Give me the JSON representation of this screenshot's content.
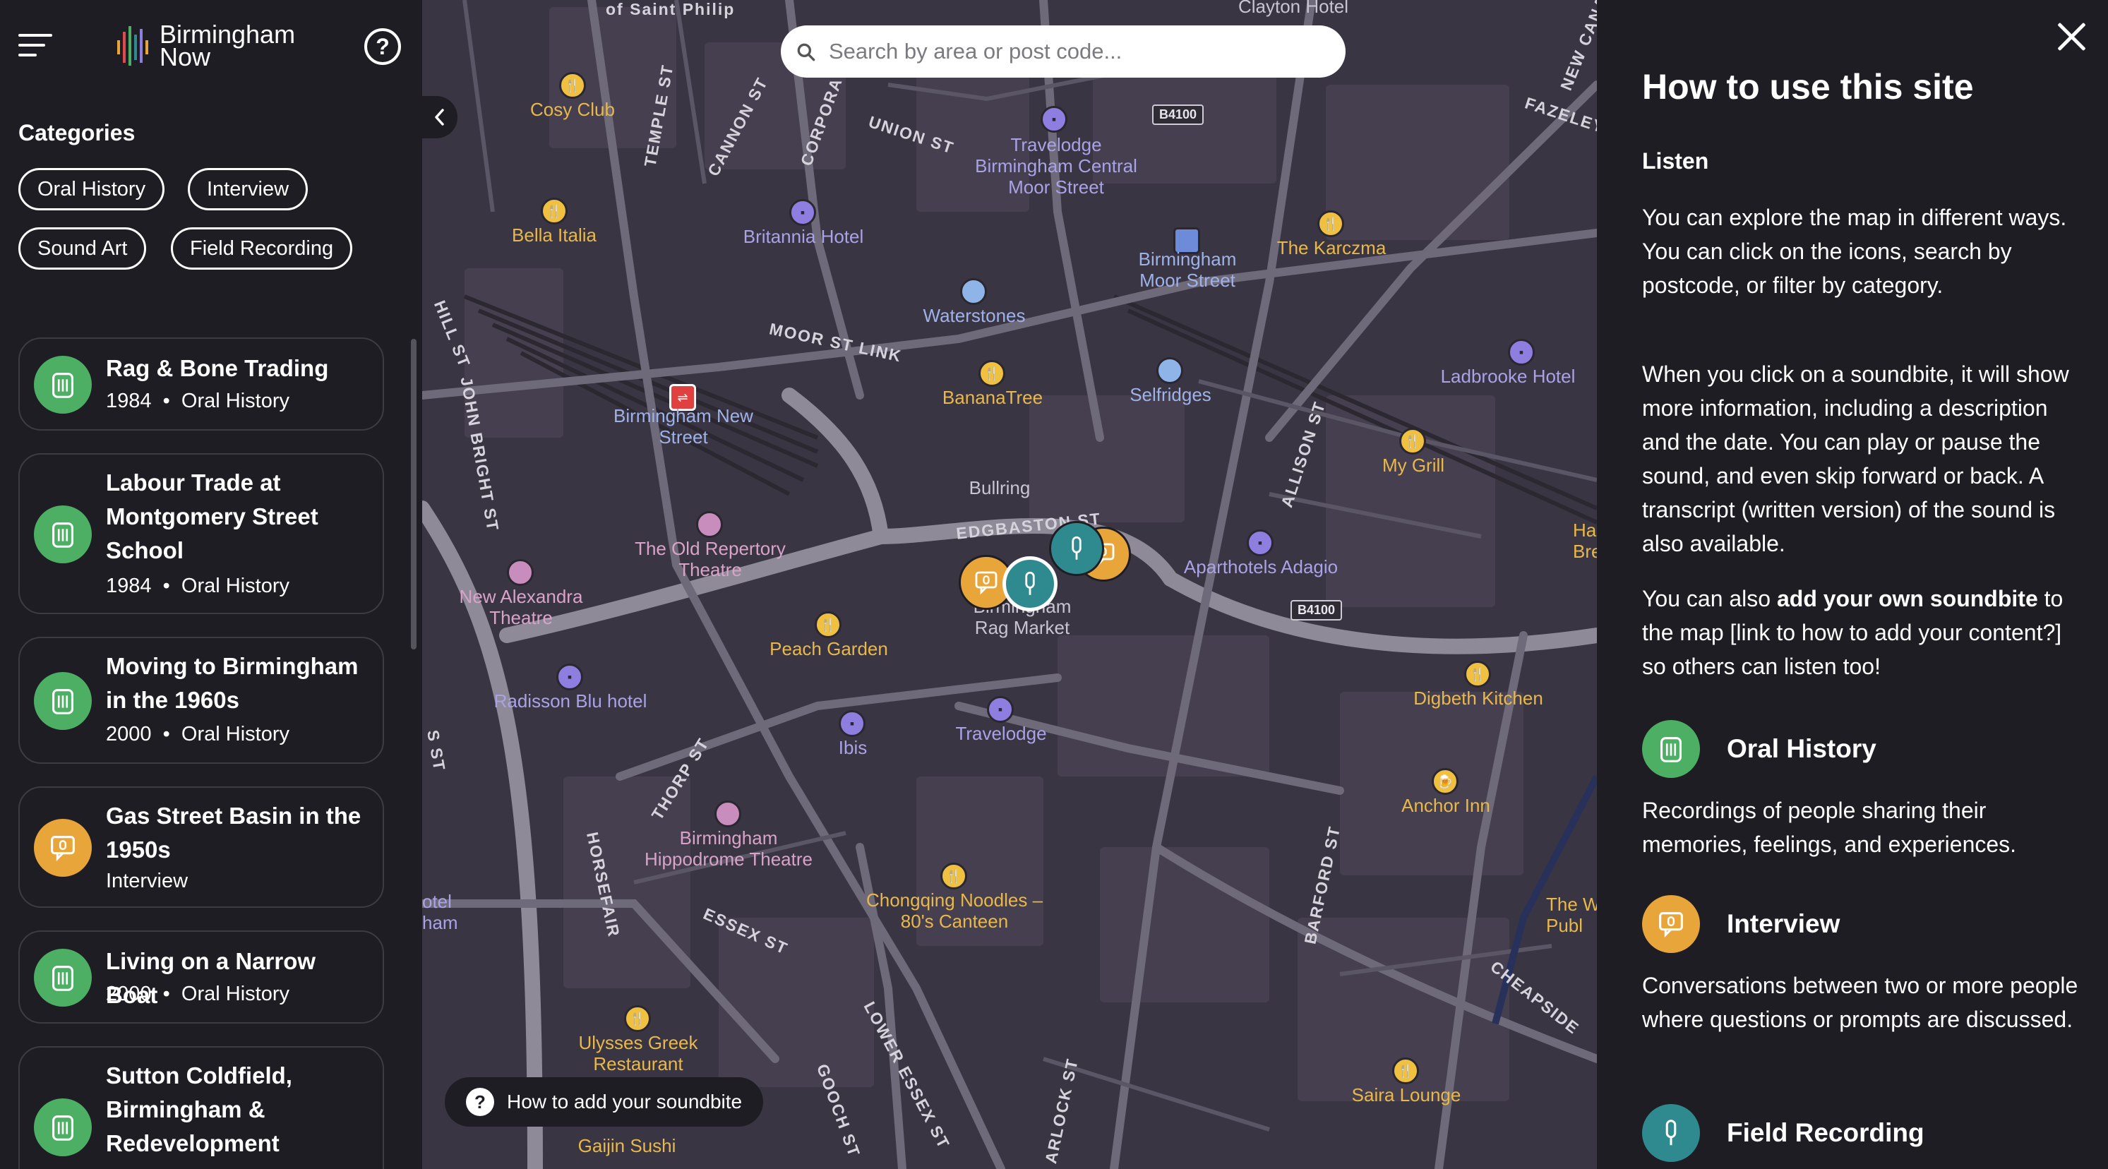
{
  "app": {
    "logo_line1": "Birmingham",
    "logo_line2": "Now",
    "help_label": "?"
  },
  "sidebar": {
    "categories_heading": "Categories",
    "chips": [
      "Oral History",
      "Interview",
      "Sound Art",
      "Field Recording"
    ],
    "cards": [
      {
        "title": "Rag & Bone Trading",
        "year": "1984",
        "category": "Oral History",
        "type": "oral"
      },
      {
        "title": "Labour Trade at Montgomery Street School",
        "year": "1984",
        "category": "Oral History",
        "type": "oral"
      },
      {
        "title": "Moving to Birmingham in the 1960s",
        "year": "2000",
        "category": "Oral History",
        "type": "oral"
      },
      {
        "title": "Gas Street Basin in the 1950s",
        "year": "",
        "category": "Interview",
        "type": "interview"
      },
      {
        "title": "Living on a Narrow Boat",
        "year": "2000",
        "category": "Oral History",
        "type": "oral"
      },
      {
        "title": "Sutton Coldfield, Birmingham & Redevelopment",
        "year": "",
        "category": "",
        "type": "oral"
      }
    ]
  },
  "map": {
    "search_placeholder": "Search by area or post code...",
    "how_to_add": "How to add your soundbite",
    "question_mark": "?",
    "streets": [
      "of Saint Philip",
      "UNION ST",
      "CANNON ST",
      "TEMPLE ST",
      "CORPORATION",
      "MOOR ST LINK",
      "HILL ST",
      "JOHN BRIGHT ST",
      "EDGBASTON ST",
      "ALLISON ST",
      "BARFORD ST",
      "CHEAPSIDE",
      "ESSEX ST",
      "THORP ST",
      "HORSEFAIR",
      "LOWER ESSEX ST",
      "GOOCH ST",
      "FAZELEY",
      "NEW CANAL",
      "S ST",
      "ARLOCK ST",
      "Clayton Hotel"
    ],
    "road_shields": [
      "B4100",
      "B4100"
    ],
    "pois": [
      {
        "name": "Cosy Club",
        "kind": "food"
      },
      {
        "name": "Bella Italia",
        "kind": "food"
      },
      {
        "name": "Britannia Hotel",
        "kind": "hotel"
      },
      {
        "name": "Travelodge Birmingham Central Moor Street",
        "kind": "hotel"
      },
      {
        "name": "Birmingham Moor Street",
        "kind": "station"
      },
      {
        "name": "The Karczma",
        "kind": "food"
      },
      {
        "name": "Waterstones",
        "kind": "shop"
      },
      {
        "name": "BananaTree",
        "kind": "food"
      },
      {
        "name": "Selfridges",
        "kind": "shop"
      },
      {
        "name": "Ladbrooke Hotel",
        "kind": "hotel"
      },
      {
        "name": "Birmingham New Street",
        "kind": "station"
      },
      {
        "name": "Bullring",
        "kind": "plain"
      },
      {
        "name": "My Grill",
        "kind": "food"
      },
      {
        "name": "The Old Repertory Theatre",
        "kind": "theatre"
      },
      {
        "name": "New Alexandra Theatre",
        "kind": "theatre"
      },
      {
        "name": "Aparthotels Adagio",
        "kind": "hotel"
      },
      {
        "name": "Halton Brewing",
        "kind": "food"
      },
      {
        "name": "Birmingham Rag Market",
        "kind": "plain"
      },
      {
        "name": "Peach Garden",
        "kind": "food"
      },
      {
        "name": "Radisson Blu hotel",
        "kind": "hotel"
      },
      {
        "name": "Ibis",
        "kind": "hotel"
      },
      {
        "name": "Travelodge",
        "kind": "hotel"
      },
      {
        "name": "Digbeth Kitchen",
        "kind": "food"
      },
      {
        "name": "Anchor Inn",
        "kind": "food"
      },
      {
        "name": "Birmingham Hippodrome Theatre",
        "kind": "theatre"
      },
      {
        "name": "Chongqing Noodles – 80's Canteen",
        "kind": "food"
      },
      {
        "name": "The W Publ",
        "kind": "food"
      },
      {
        "name": "Ulysses Greek Restaurant",
        "kind": "food"
      },
      {
        "name": "Saira Lounge",
        "kind": "food"
      },
      {
        "name": "Gaijin Sushi",
        "kind": "food"
      },
      {
        "name": "otel ham",
        "kind": "hotel"
      }
    ]
  },
  "panel": {
    "title": "How to use this site",
    "subtitle": "Listen",
    "para1": "You can explore the map in different ways. You can click on the icons, search by postcode, or filter by category.",
    "para2": "When you click on a soundbite, it will show more information, including a description and the date. You can play or pause the sound, and even skip forward or back. A transcript (written version) of the sound is also available.",
    "para3_prefix": "You can also ",
    "para3_bold": "add your own soundbite",
    "para3_suffix": " to the map [link to how to add your content?] so others can listen too!",
    "legend": [
      {
        "label": "Oral History",
        "desc": "Recordings of people sharing their memories, feelings, and experiences.",
        "type": "oral"
      },
      {
        "label": "Interview",
        "desc": "Conversations between two or more people where questions or prompts are discussed.",
        "type": "interview"
      },
      {
        "label": "Field Recording",
        "desc": "",
        "type": "field"
      }
    ]
  },
  "colors": {
    "oral": "#4caf63",
    "interview": "#e8a63a",
    "field": "#2f8a8f",
    "background": "#1e1d23",
    "map": "#3a3543"
  }
}
